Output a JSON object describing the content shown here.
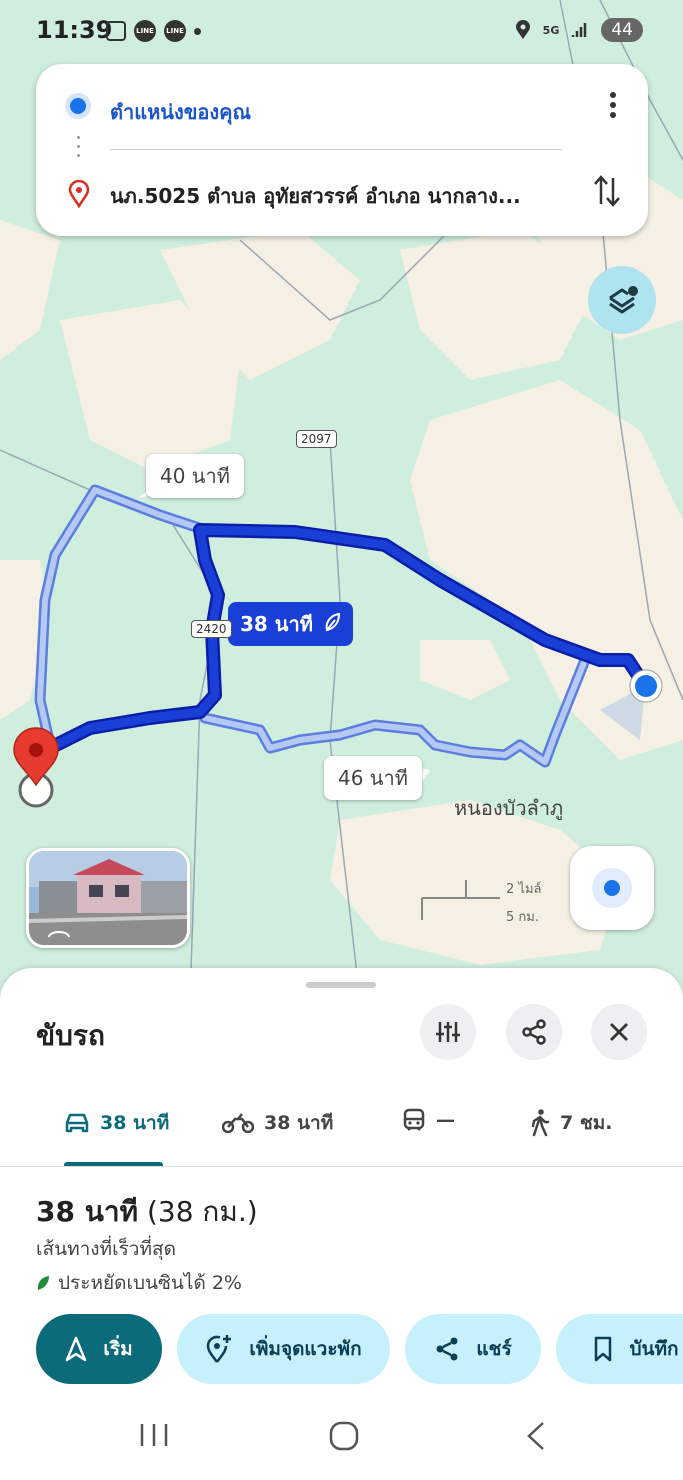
{
  "status_bar": {
    "time": "11:39",
    "icons": [
      "screenshot-icon",
      "line-icon",
      "line-icon",
      "dot-icon"
    ],
    "right_icons": [
      "location-icon",
      "5g-signal-icon",
      "signal-icon"
    ],
    "network": "5G",
    "battery": "44"
  },
  "route_card": {
    "from_label": "ตำแหน่งของคุณ",
    "to_label": "นภ.5025 ตำบล อุทัยสวรรค์ อำเภอ นากลาง..."
  },
  "map": {
    "route_times": {
      "alt_top": "40 นาที",
      "main": "38 นาที",
      "alt_bottom": "46 นาที"
    },
    "road_shields": [
      "2097",
      "2420"
    ],
    "place_label": "หนองบัวลำภู",
    "scale": {
      "miles": "2 ไมล์",
      "km": "5 กม."
    },
    "colors": {
      "main_route": "#1a3fd6",
      "alt_route": "#8fb0f0",
      "map_green": "#cfeedd",
      "map_tan": "#f5efe4"
    }
  },
  "sheet": {
    "title": "ขับรถ",
    "modes": [
      {
        "icon": "car-icon",
        "label": "38 นาที",
        "active": true
      },
      {
        "icon": "motorcycle-icon",
        "label": "38 นาที",
        "active": false
      },
      {
        "icon": "train-icon",
        "label": "—",
        "active": false
      },
      {
        "icon": "walk-icon",
        "label": "7 ชม.",
        "active": false
      }
    ],
    "summary_time": "38 นาที",
    "summary_dist": "(38 กม.)",
    "fastest": "เส้นทางที่เร็วที่สุด",
    "eco": "ประหยัดเบนซินได้ 2%",
    "actions": {
      "start": "เริ่ม",
      "add_stop": "เพิ่มจุดแวะพัก",
      "share": "แชร์",
      "save": "บันทึก"
    },
    "accent": "#0b6b7a"
  }
}
